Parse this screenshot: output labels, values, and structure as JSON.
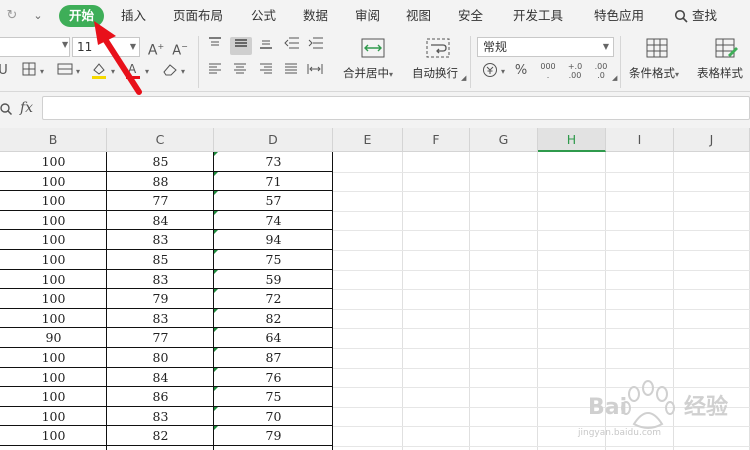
{
  "menubar": {
    "items": [
      {
        "label": "开始",
        "active": true
      },
      {
        "label": "插入"
      },
      {
        "label": "页面布局"
      },
      {
        "label": "公式"
      },
      {
        "label": "数据"
      },
      {
        "label": "审阅"
      },
      {
        "label": "视图"
      },
      {
        "label": "安全"
      },
      {
        "label": "开发工具"
      },
      {
        "label": "特色应用"
      }
    ],
    "search_label": "查找",
    "active_color": "#3eae58"
  },
  "ribbon": {
    "font_size": "11",
    "number_format": "常规",
    "merge_center_label": "合并居中",
    "wrap_text_label": "自动换行",
    "conditional_format_label": "条件格式",
    "table_style_label": "表格样式",
    "decimal_increase_label": ".00",
    "decimal_decrease_label": ".0",
    "thousands_label": "000"
  },
  "formula_bar": {
    "fx_label": "fx",
    "value": ""
  },
  "columns": [
    "B",
    "C",
    "D",
    "E",
    "F",
    "G",
    "H",
    "I",
    "J"
  ],
  "active_column": "H",
  "rows": [
    {
      "B": "100",
      "C": "85",
      "D": "73"
    },
    {
      "B": "100",
      "C": "88",
      "D": "71"
    },
    {
      "B": "100",
      "C": "77",
      "D": "57"
    },
    {
      "B": "100",
      "C": "84",
      "D": "74"
    },
    {
      "B": "100",
      "C": "83",
      "D": "94"
    },
    {
      "B": "100",
      "C": "85",
      "D": "75"
    },
    {
      "B": "100",
      "C": "83",
      "D": "59"
    },
    {
      "B": "100",
      "C": "79",
      "D": "72"
    },
    {
      "B": "100",
      "C": "83",
      "D": "82"
    },
    {
      "B": "90",
      "C": "77",
      "D": "64"
    },
    {
      "B": "100",
      "C": "80",
      "D": "87"
    },
    {
      "B": "100",
      "C": "84",
      "D": "76"
    },
    {
      "B": "100",
      "C": "86",
      "D": "75"
    },
    {
      "B": "100",
      "C": "83",
      "D": "70"
    },
    {
      "B": "100",
      "C": "82",
      "D": "79"
    }
  ],
  "watermark": {
    "brand": "Baidu经验",
    "url": "jingyan.baidu.com"
  },
  "colors": {
    "accent": "#3eae58",
    "arrow": "#e8101a"
  }
}
